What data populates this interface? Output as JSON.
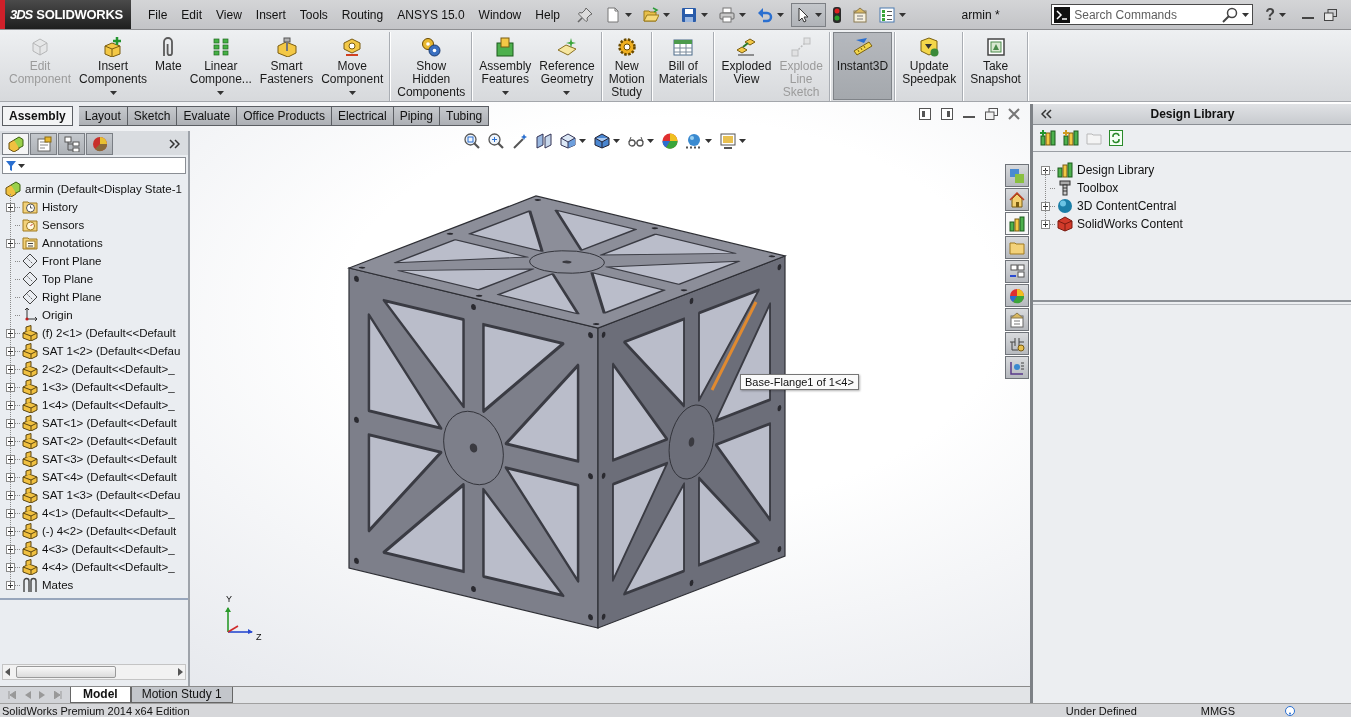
{
  "title_bar": {
    "logo_mark": "3DS",
    "logo_text": "SOLIDWORKS",
    "menu": [
      "File",
      "Edit",
      "View",
      "Insert",
      "Tools",
      "Routing",
      "ANSYS 15.0",
      "Window",
      "Help"
    ],
    "quick_access": [
      {
        "selected": false
      },
      {
        "selected": false
      },
      {
        "selected": false
      },
      {
        "selected": false
      },
      {
        "selected": false
      },
      {
        "selected": true
      },
      {
        "selected": false
      },
      {
        "selected": false
      },
      {
        "selected": false
      }
    ],
    "document_title": "armin *",
    "search": {
      "placeholder": "Search Commands"
    },
    "help": "?"
  },
  "command_manager": {
    "groups": [
      [
        {
          "label": "Edit\nComponent",
          "disabled": true,
          "selected": false,
          "dropdown": false
        },
        {
          "label": "Insert\nComponents",
          "disabled": false,
          "selected": false,
          "dropdown": true
        },
        {
          "label": "Mate",
          "disabled": false,
          "selected": false,
          "dropdown": false
        },
        {
          "label": "Linear\nCompone...",
          "disabled": false,
          "selected": false,
          "dropdown": true
        },
        {
          "label": "Smart\nFasteners",
          "disabled": false,
          "selected": false,
          "dropdown": false
        },
        {
          "label": "Move\nComponent",
          "disabled": false,
          "selected": false,
          "dropdown": true
        }
      ],
      [
        {
          "label": "Show\nHidden\nComponents",
          "disabled": false,
          "selected": false,
          "dropdown": false
        }
      ],
      [
        {
          "label": "Assembly\nFeatures",
          "disabled": false,
          "selected": false,
          "dropdown": true
        },
        {
          "label": "Reference\nGeometry",
          "disabled": false,
          "selected": false,
          "dropdown": true
        }
      ],
      [
        {
          "label": "New\nMotion\nStudy",
          "disabled": false,
          "selected": false,
          "dropdown": false
        }
      ],
      [
        {
          "label": "Bill of\nMaterials",
          "disabled": false,
          "selected": false,
          "dropdown": false
        }
      ],
      [
        {
          "label": "Exploded\nView",
          "disabled": false,
          "selected": false,
          "dropdown": false
        },
        {
          "label": "Explode\nLine\nSketch",
          "disabled": true,
          "selected": false,
          "dropdown": false
        }
      ],
      [
        {
          "label": "Instant3D",
          "disabled": false,
          "selected": true,
          "dropdown": false
        }
      ],
      [
        {
          "label": "Update\nSpeedpak",
          "disabled": false,
          "selected": false,
          "dropdown": false
        }
      ],
      [
        {
          "label": "Take\nSnapshot",
          "disabled": false,
          "selected": false,
          "dropdown": false
        }
      ]
    ],
    "tabs": [
      {
        "label": "Assembly",
        "selected": true
      },
      {
        "label": "Layout",
        "selected": false
      },
      {
        "label": "Sketch",
        "selected": false
      },
      {
        "label": "Evaluate",
        "selected": false
      },
      {
        "label": "Office Products",
        "selected": false
      },
      {
        "label": "Electrical",
        "selected": false
      },
      {
        "label": "Piping",
        "selected": false
      },
      {
        "label": "Tubing",
        "selected": false
      }
    ]
  },
  "feature_tree": {
    "tabs": [
      {
        "selected": true
      },
      {
        "selected": false
      },
      {
        "selected": false
      },
      {
        "selected": false
      }
    ],
    "root": {
      "label": "armin (Default<Display State-1",
      "kind": "assembly",
      "children": [
        {
          "label": "History",
          "kind": "history",
          "expandable": true
        },
        {
          "label": "Sensors",
          "kind": "sensors",
          "expandable": false
        },
        {
          "label": "Annotations",
          "kind": "annotations",
          "expandable": true
        },
        {
          "label": "Front Plane",
          "kind": "plane",
          "expandable": false
        },
        {
          "label": "Top Plane",
          "kind": "plane",
          "expandable": false
        },
        {
          "label": "Right Plane",
          "kind": "plane",
          "expandable": false
        },
        {
          "label": "Origin",
          "kind": "origin",
          "expandable": false
        },
        {
          "label": "(f) 2<1> (Default<<Default",
          "kind": "component",
          "expandable": true
        },
        {
          "label": "SAT 1<2> (Default<<Defau",
          "kind": "component",
          "expandable": true
        },
        {
          "label": "2<2> (Default<<Default>_",
          "kind": "component",
          "expandable": true
        },
        {
          "label": "1<3> (Default<<Default>_",
          "kind": "component",
          "expandable": true
        },
        {
          "label": "1<4> (Default<<Default>_",
          "kind": "component",
          "expandable": true
        },
        {
          "label": "SAT<1> (Default<<Default",
          "kind": "component",
          "expandable": true
        },
        {
          "label": "SAT<2> (Default<<Default",
          "kind": "component",
          "expandable": true
        },
        {
          "label": "SAT<3> (Default<<Default",
          "kind": "component",
          "expandable": true
        },
        {
          "label": "SAT<4> (Default<<Default",
          "kind": "component",
          "expandable": true
        },
        {
          "label": "SAT 1<3> (Default<<Defau",
          "kind": "component",
          "expandable": true
        },
        {
          "label": "4<1> (Default<<Default>_",
          "kind": "component",
          "expandable": true
        },
        {
          "label": "(-) 4<2> (Default<<Default",
          "kind": "component",
          "expandable": true
        },
        {
          "label": "4<3> (Default<<Default>_",
          "kind": "component",
          "expandable": true
        },
        {
          "label": "4<4> (Default<<Default>_",
          "kind": "component",
          "expandable": true
        },
        {
          "label": "Mates",
          "kind": "mates",
          "expandable": true
        }
      ]
    }
  },
  "viewport": {
    "tooltip": "Base-Flange1 of 1<4>",
    "triad": [
      "Y",
      "Z"
    ]
  },
  "bottom_tabs": [
    {
      "label": "Model",
      "selected": true
    },
    {
      "label": "Motion Study 1",
      "selected": false
    }
  ],
  "task_pane": {
    "tabs": [
      {
        "selected": false
      },
      {
        "selected": false
      },
      {
        "selected": true
      },
      {
        "selected": false
      },
      {
        "selected": false
      },
      {
        "selected": false
      },
      {
        "selected": false
      },
      {
        "selected": false
      },
      {
        "selected": false
      }
    ],
    "title": "Design Library",
    "tree": [
      {
        "label": "Design Library",
        "kind": "library",
        "expandable": true
      },
      {
        "label": "Toolbox",
        "kind": "toolbox",
        "expandable": false
      },
      {
        "label": "3D ContentCentral",
        "kind": "content-central",
        "expandable": true
      },
      {
        "label": "SolidWorks Content",
        "kind": "solidworks-content",
        "expandable": true
      }
    ]
  },
  "status_bar": {
    "left": "SolidWorks Premium 2014 x64 Edition",
    "right": [
      "Under Defined",
      "MMGS"
    ]
  }
}
